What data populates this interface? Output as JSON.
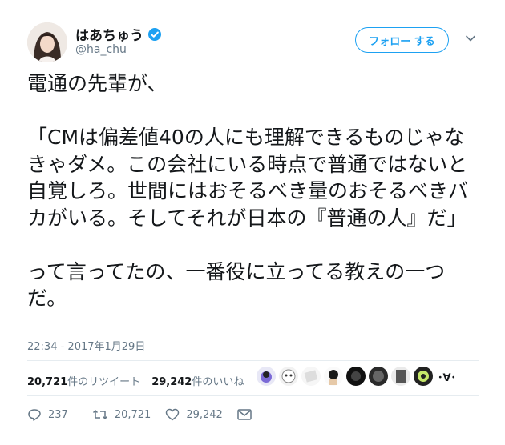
{
  "user": {
    "name": "はあちゅう",
    "handle": "@ha_chu",
    "verified": true
  },
  "follow_button": {
    "label": "フォロー する"
  },
  "tweet": {
    "text": "電通の先輩が、\n\n「CMは偏差値40の人にも理解できるものじゃなきゃダメ。この会社にいる時点で普通ではないと自覚しろ。世間にはおそるべき量のおそるべきバカがいる。そしてそれが日本の『普通の人』だ」\n\nって言ってたの、一番役に立ってる教えの一つだ。",
    "timestamp": "22:34 - 2017年1月29日"
  },
  "stats": {
    "retweets_count": "20,721",
    "retweets_label": "件のリツイート",
    "likes_count": "29,242",
    "likes_label": "件のいいね",
    "likers_suffix": "･∀･"
  },
  "actions": {
    "reply_count": "237",
    "retweet_count": "20,721",
    "like_count": "29,242"
  },
  "colors": {
    "accent": "#1da1f2",
    "secondary_text": "#657786",
    "divider": "#e6ecf0"
  }
}
